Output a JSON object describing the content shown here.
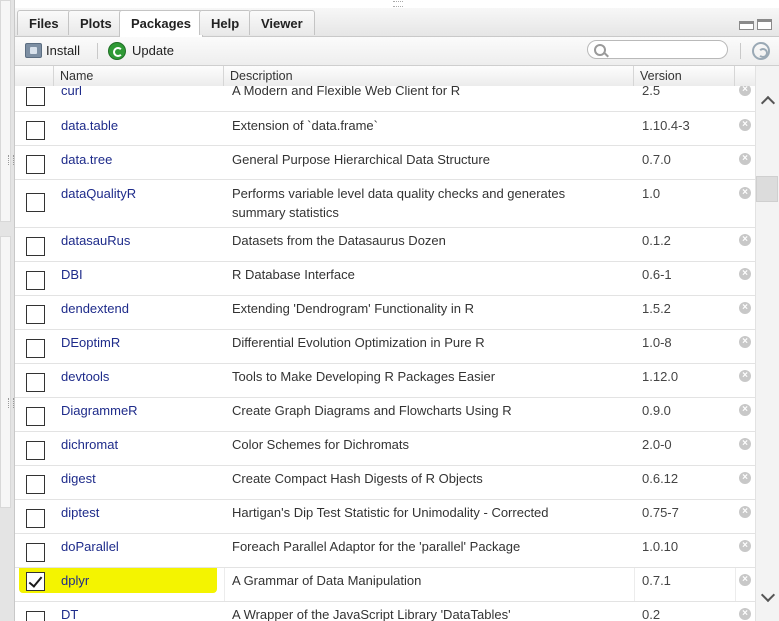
{
  "tabs": [
    "Files",
    "Plots",
    "Packages",
    "Help",
    "Viewer"
  ],
  "active_tab": "Packages",
  "toolbar": {
    "install_label": "Install",
    "update_label": "Update",
    "search_placeholder": ""
  },
  "columns": {
    "name": "Name",
    "description": "Description",
    "version": "Version"
  },
  "packages": [
    {
      "name": "curl",
      "description": "A Modern and Flexible Web Client for R",
      "version": "2.5",
      "checked": false
    },
    {
      "name": "data.table",
      "description": "Extension of `data.frame`",
      "version": "1.10.4-3",
      "checked": false
    },
    {
      "name": "data.tree",
      "description": "General Purpose Hierarchical Data Structure",
      "version": "0.7.0",
      "checked": false
    },
    {
      "name": "dataQualityR",
      "description": "Performs variable level data quality checks and generates summary statistics",
      "version": "1.0",
      "checked": false
    },
    {
      "name": "datasauRus",
      "description": "Datasets from the Datasaurus Dozen",
      "version": "0.1.2",
      "checked": false
    },
    {
      "name": "DBI",
      "description": "R Database Interface",
      "version": "0.6-1",
      "checked": false
    },
    {
      "name": "dendextend",
      "description": "Extending 'Dendrogram' Functionality in R",
      "version": "1.5.2",
      "checked": false
    },
    {
      "name": "DEoptimR",
      "description": "Differential Evolution Optimization in Pure R",
      "version": "1.0-8",
      "checked": false
    },
    {
      "name": "devtools",
      "description": "Tools to Make Developing R Packages Easier",
      "version": "1.12.0",
      "checked": false
    },
    {
      "name": "DiagrammeR",
      "description": "Create Graph Diagrams and Flowcharts Using R",
      "version": "0.9.0",
      "checked": false
    },
    {
      "name": "dichromat",
      "description": "Color Schemes for Dichromats",
      "version": "2.0-0",
      "checked": false
    },
    {
      "name": "digest",
      "description": "Create Compact Hash Digests of R Objects",
      "version": "0.6.12",
      "checked": false
    },
    {
      "name": "diptest",
      "description": "Hartigan's Dip Test Statistic for Unimodality - Corrected",
      "version": "0.75-7",
      "checked": false
    },
    {
      "name": "doParallel",
      "description": "Foreach Parallel Adaptor for the 'parallel' Package",
      "version": "1.0.10",
      "checked": false
    },
    {
      "name": "dplyr",
      "description": "A Grammar of Data Manipulation",
      "version": "0.7.1",
      "checked": true
    },
    {
      "name": "DT",
      "description": "A Wrapper of the JavaScript Library 'DataTables'",
      "version": "0.2",
      "checked": false
    }
  ],
  "colors": {
    "package_link": "#1e2b8a",
    "highlight": "#f4f400",
    "update_icon": "#2f9a36"
  }
}
